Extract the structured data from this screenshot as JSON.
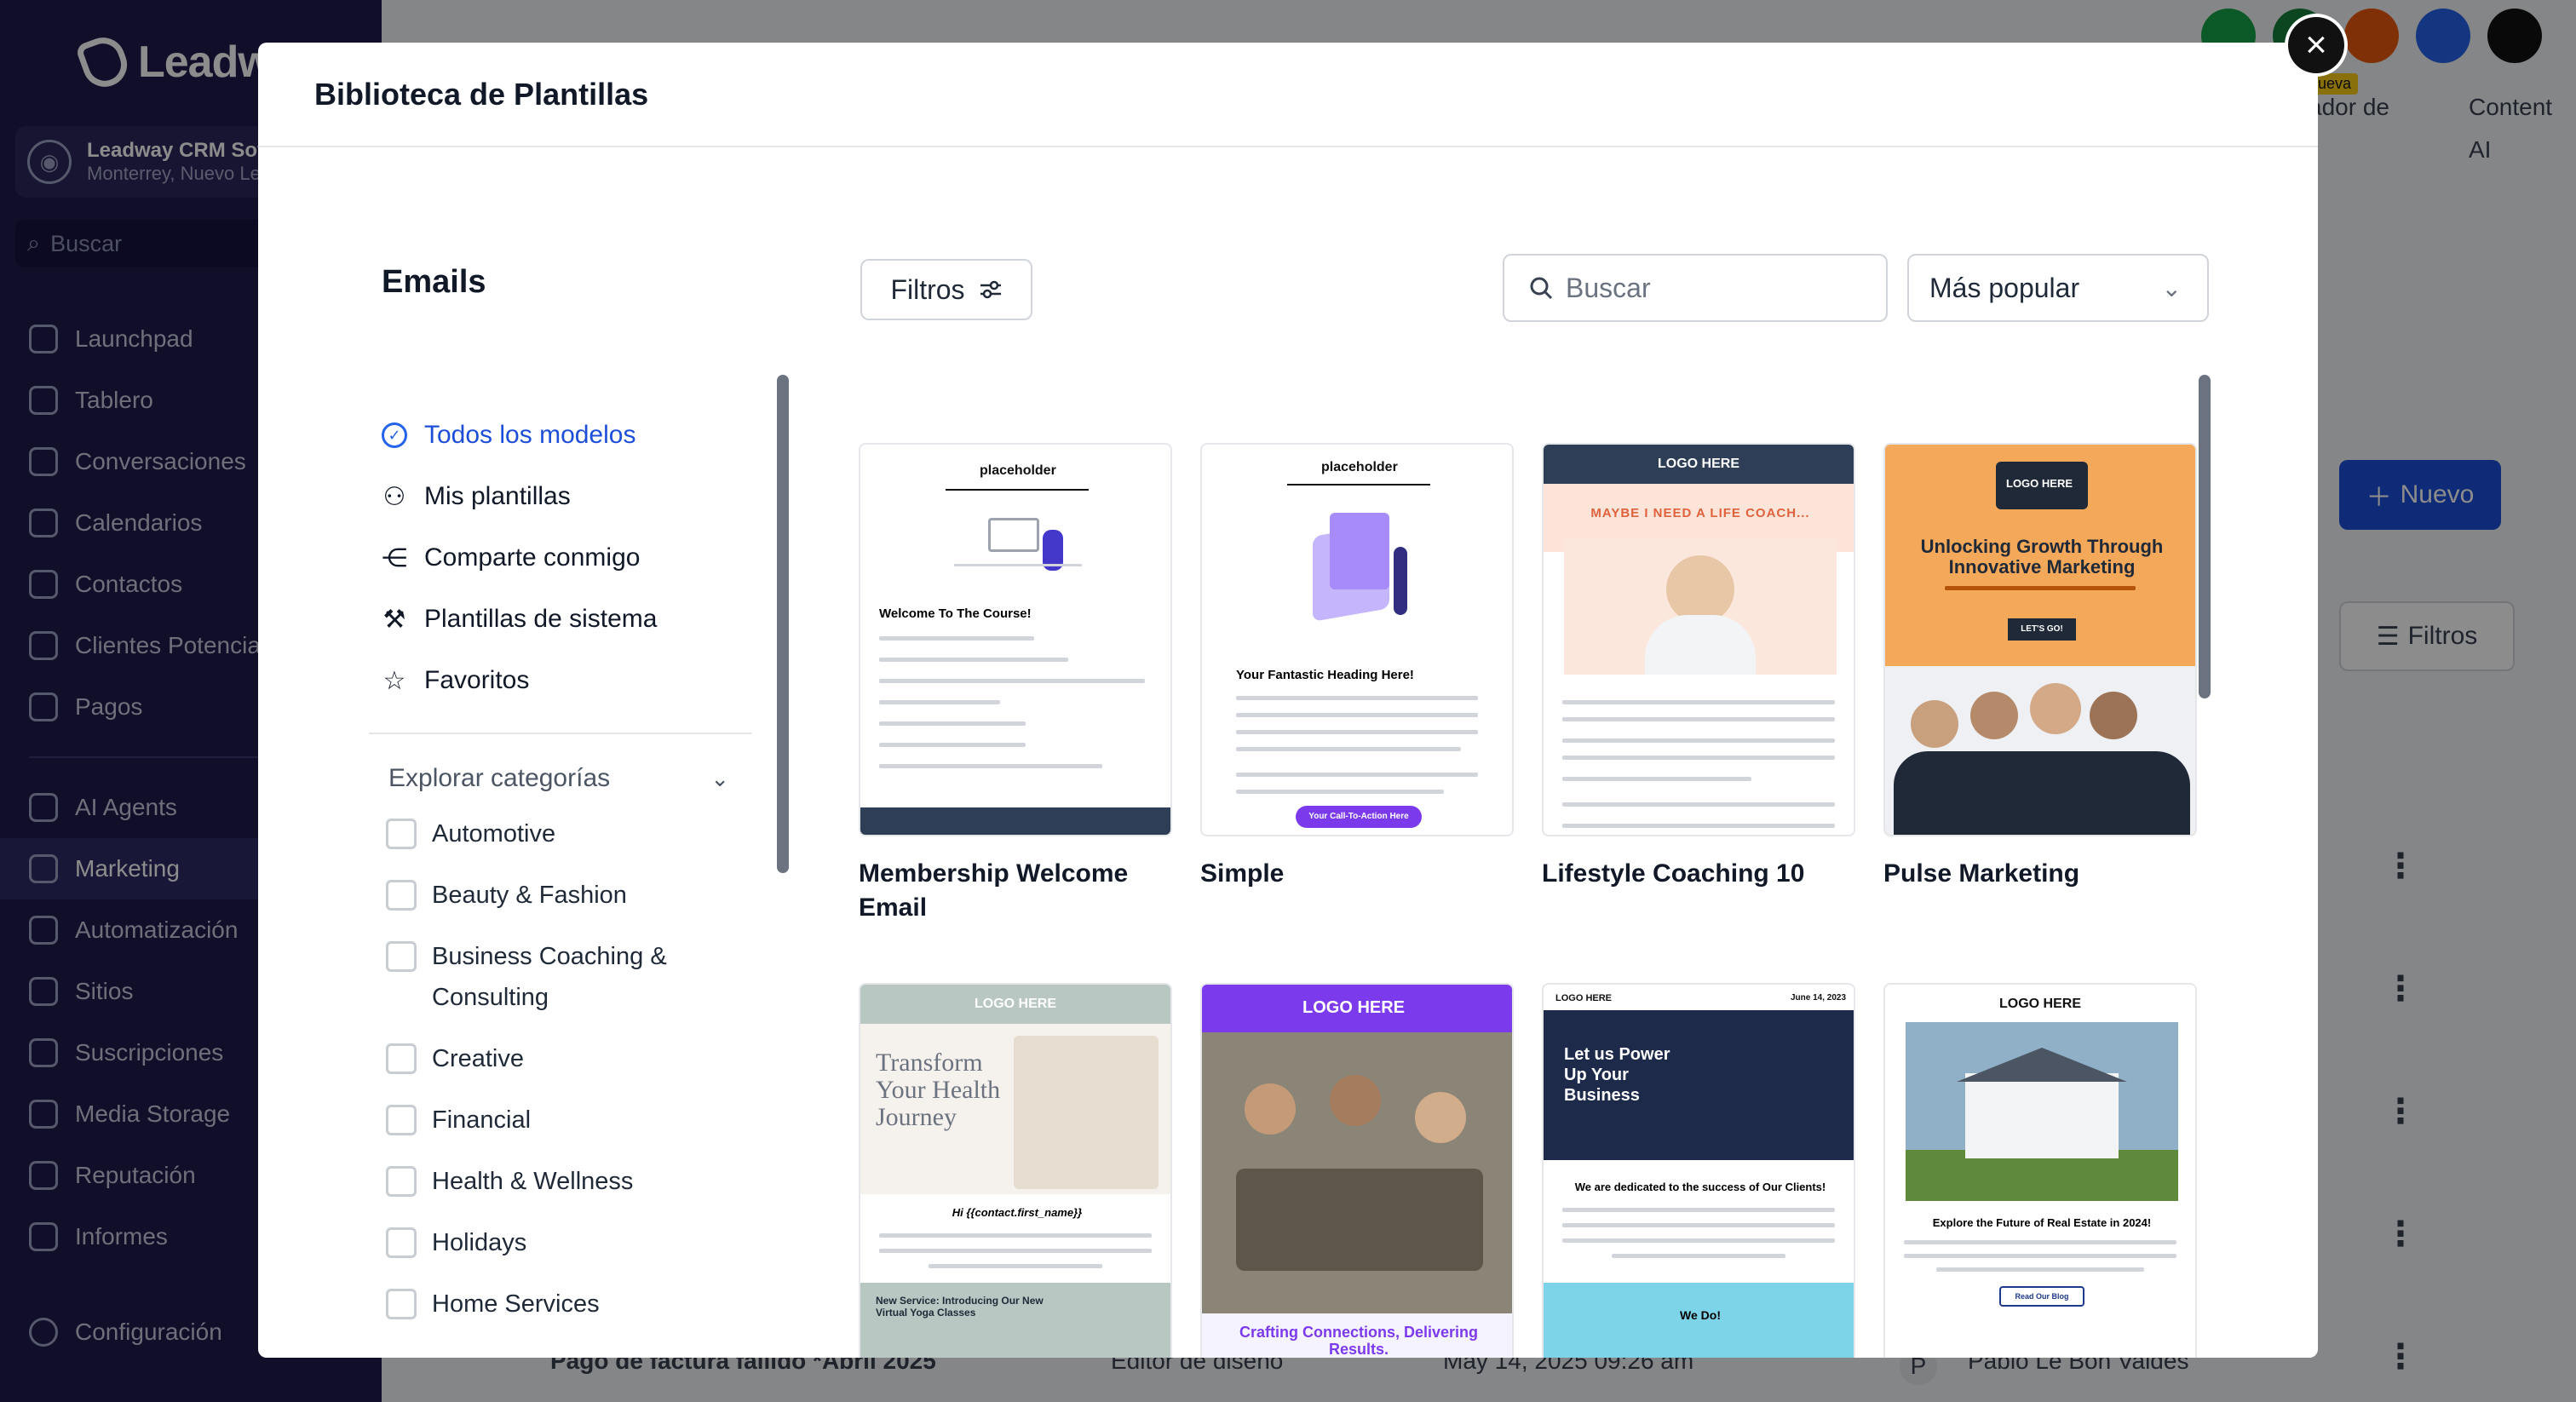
{
  "sidebar": {
    "logo": "Leadwa",
    "account_name": "Leadway CRM Softw",
    "account_location": "Monterrey, Nuevo Le",
    "search_placeholder": "Buscar",
    "items": [
      {
        "label": "Launchpad",
        "icon": "rocket-icon"
      },
      {
        "label": "Tablero",
        "icon": "dashboard-icon"
      },
      {
        "label": "Conversaciones",
        "icon": "chat-icon"
      },
      {
        "label": "Calendarios",
        "icon": "calendar-icon"
      },
      {
        "label": "Contactos",
        "icon": "contacts-icon"
      },
      {
        "label": "Clientes Potencia",
        "icon": "leads-icon"
      },
      {
        "label": "Pagos",
        "icon": "payments-icon"
      }
    ],
    "items2": [
      {
        "label": "AI Agents",
        "icon": "sparkle-icon"
      },
      {
        "label": "Marketing",
        "icon": "send-icon"
      },
      {
        "label": "Automatización",
        "icon": "automation-icon"
      },
      {
        "label": "Sitios",
        "icon": "sites-icon"
      },
      {
        "label": "Suscripciones",
        "icon": "subscriptions-icon"
      },
      {
        "label": "Media Storage",
        "icon": "image-icon"
      },
      {
        "label": "Reputación",
        "icon": "star-icon"
      },
      {
        "label": "Informes",
        "icon": "chart-icon"
      }
    ],
    "settings_label": "Configuración"
  },
  "background": {
    "tab_partial": "ador de",
    "tab_content": "Content",
    "tab_ai": "AI",
    "badge": "Nueva",
    "new_button": "Nuevo",
    "filters_button": "Filtros",
    "row_name": "Pago de factura fallido *Abril 2025",
    "row_type": "Editor de diseño",
    "row_date": "May 14, 2025 09:26 am",
    "row_owner": "Pablo Le Bon Valdes",
    "row_owner_initial": "P"
  },
  "modal": {
    "title": "Biblioteca de Plantillas",
    "section_title": "Emails",
    "filters_label": "Filtros",
    "search_placeholder": "Buscar",
    "sort_label": "Más popular",
    "nav": [
      {
        "label": "Todos los modelos",
        "icon": "check-circle-icon",
        "active": true
      },
      {
        "label": "Mis plantillas",
        "icon": "user-icon"
      },
      {
        "label": "Comparte conmigo",
        "icon": "share-icon"
      },
      {
        "label": "Plantillas de sistema",
        "icon": "wrench-icon"
      },
      {
        "label": "Favoritos",
        "icon": "star-icon"
      }
    ],
    "explore_label": "Explorar categorías",
    "categories": [
      "Automotive",
      "Beauty & Fashion",
      "Business Coaching & Consulting",
      "Creative",
      "Financial",
      "Health & Wellness",
      "Holidays",
      "Home Services"
    ],
    "templates": [
      {
        "title": "Membership Welcome Email",
        "thumb_heading": "Welcome To The Course!",
        "thumb_logo": "placeholder"
      },
      {
        "title": "Simple",
        "thumb_heading": "Your Fantastic Heading Here!",
        "thumb_logo": "placeholder",
        "thumb_cta": "Your Call-To-Action Here"
      },
      {
        "title": "Lifestyle Coaching 10",
        "thumb_heading": "MAYBE I NEED A LIFE COACH...",
        "thumb_logo": "LOGO HERE"
      },
      {
        "title": "Pulse Marketing",
        "thumb_heading": "Unlocking Growth Through Innovative Marketing",
        "thumb_logo": "LOGO HERE",
        "thumb_cta": "LET'S GO!"
      },
      {
        "title": "",
        "thumb_heading": "Transform Your Health Journey",
        "thumb_logo": "LOGO HERE",
        "thumb_sub": "Hi {{contact.first_name}}",
        "thumb_foot": "New Service: Introducing Our New Virtual Yoga Classes"
      },
      {
        "title": "",
        "thumb_heading": "Crafting Connections, Delivering Results.",
        "thumb_logo": "LOGO HERE"
      },
      {
        "title": "",
        "thumb_heading": "Let us Power Up Your Business",
        "thumb_logo": "LOGO HERE",
        "thumb_sub": "We are dedicated to the success of Our Clients!",
        "thumb_foot": "We Do!",
        "thumb_date": "June 14, 2023"
      },
      {
        "title": "",
        "thumb_heading": "Explore the Future of Real Estate in 2024!",
        "thumb_logo": "LOGO HERE",
        "thumb_cta": "Read Our Blog"
      }
    ]
  },
  "colors": {
    "sidebar_bg": "#1e1b4b",
    "accent": "#1d4ed8",
    "pulse_orange": "#f4a85a",
    "purple": "#7c3aed"
  }
}
